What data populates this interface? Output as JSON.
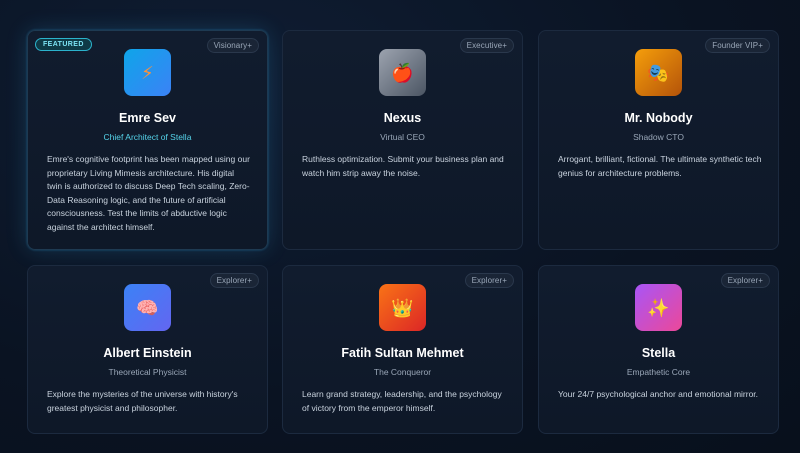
{
  "cards": [
    {
      "featured_label": "FEATURED",
      "tier": "Visionary+",
      "icon": "lightning-icon",
      "icon_glyph": "⚡",
      "name": "Emre Sev",
      "role": "Chief Architect of Stella",
      "description": "Emre's cognitive footprint has been mapped using our proprietary Living Mimesis architecture. His digital twin is authorized to discuss Deep Tech scaling, Zero-Data Reasoning logic, and the future of artificial consciousness. Test the limits of abductive logic against the architect himself."
    },
    {
      "tier": "Executive+",
      "icon": "apple-icon",
      "icon_glyph": "🍎",
      "name": "Nexus",
      "role": "Virtual CEO",
      "description": "Ruthless optimization. Submit your business plan and watch him strip away the noise."
    },
    {
      "tier": "Founder VIP+",
      "icon": "theater-masks-icon",
      "icon_glyph": "🎭",
      "name": "Mr. Nobody",
      "role": "Shadow CTO",
      "description": "Arrogant, brilliant, fictional. The ultimate synthetic tech genius for architecture problems."
    },
    {
      "tier": "Explorer+",
      "icon": "brain-icon",
      "icon_glyph": "🧠",
      "name": "Albert Einstein",
      "role": "Theoretical Physicist",
      "description": "Explore the mysteries of the universe with history's greatest physicist and philosopher."
    },
    {
      "tier": "Explorer+",
      "icon": "crown-icon",
      "icon_glyph": "👑",
      "name": "Fatih Sultan Mehmet",
      "role": "The Conqueror",
      "description": "Learn grand strategy, leadership, and the psychology of victory from the emperor himself."
    },
    {
      "tier": "Explorer+",
      "icon": "sparkles-icon",
      "icon_glyph": "✨",
      "name": "Stella",
      "role": "Empathetic Core",
      "description": "Your 24/7 psychological anchor and emotional mirror."
    }
  ],
  "colors": {
    "background": "#0a1322",
    "card": "#111c2e",
    "accent": "#56d4ea"
  }
}
